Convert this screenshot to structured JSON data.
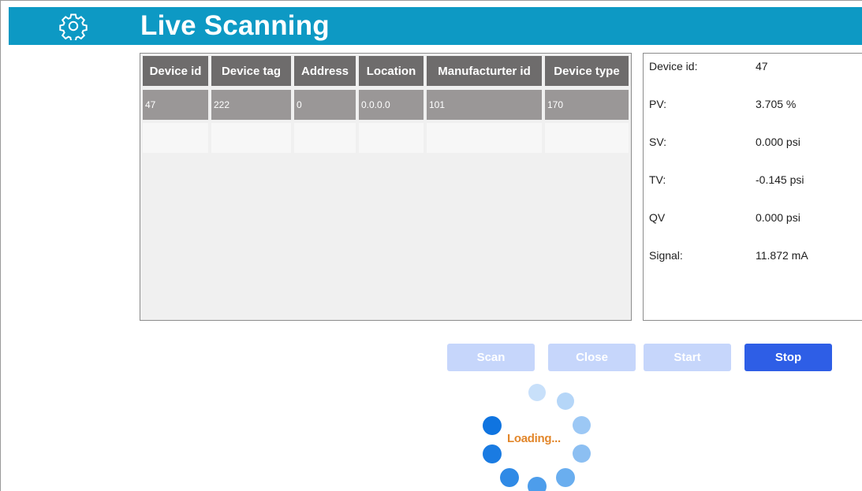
{
  "header": {
    "title": "Live Scanning",
    "icon": "gear-icon",
    "color": "#0d99c4"
  },
  "table": {
    "columns": [
      "Device id",
      "Device tag",
      "Address",
      "Location",
      "Manufacturter id",
      "Device type"
    ],
    "rows": [
      [
        "47",
        "222",
        "0",
        "0.0.0.0",
        "101",
        "170"
      ],
      [
        "",
        "",
        "",
        "",
        "",
        ""
      ]
    ]
  },
  "details": [
    {
      "label": "Device id:",
      "value": "47"
    },
    {
      "label": "PV:",
      "value": "3.705 %"
    },
    {
      "label": "SV:",
      "value": "0.000 psi"
    },
    {
      "label": "TV:",
      "value": "-0.145 psi"
    },
    {
      "label": "QV",
      "value": "0.000 psi"
    },
    {
      "label": "Signal:",
      "value": "11.872 mA"
    }
  ],
  "buttons": {
    "scan": "Scan",
    "close": "Close",
    "start": "Start",
    "stop": "Stop"
  },
  "loading": {
    "text": "Loading..."
  }
}
